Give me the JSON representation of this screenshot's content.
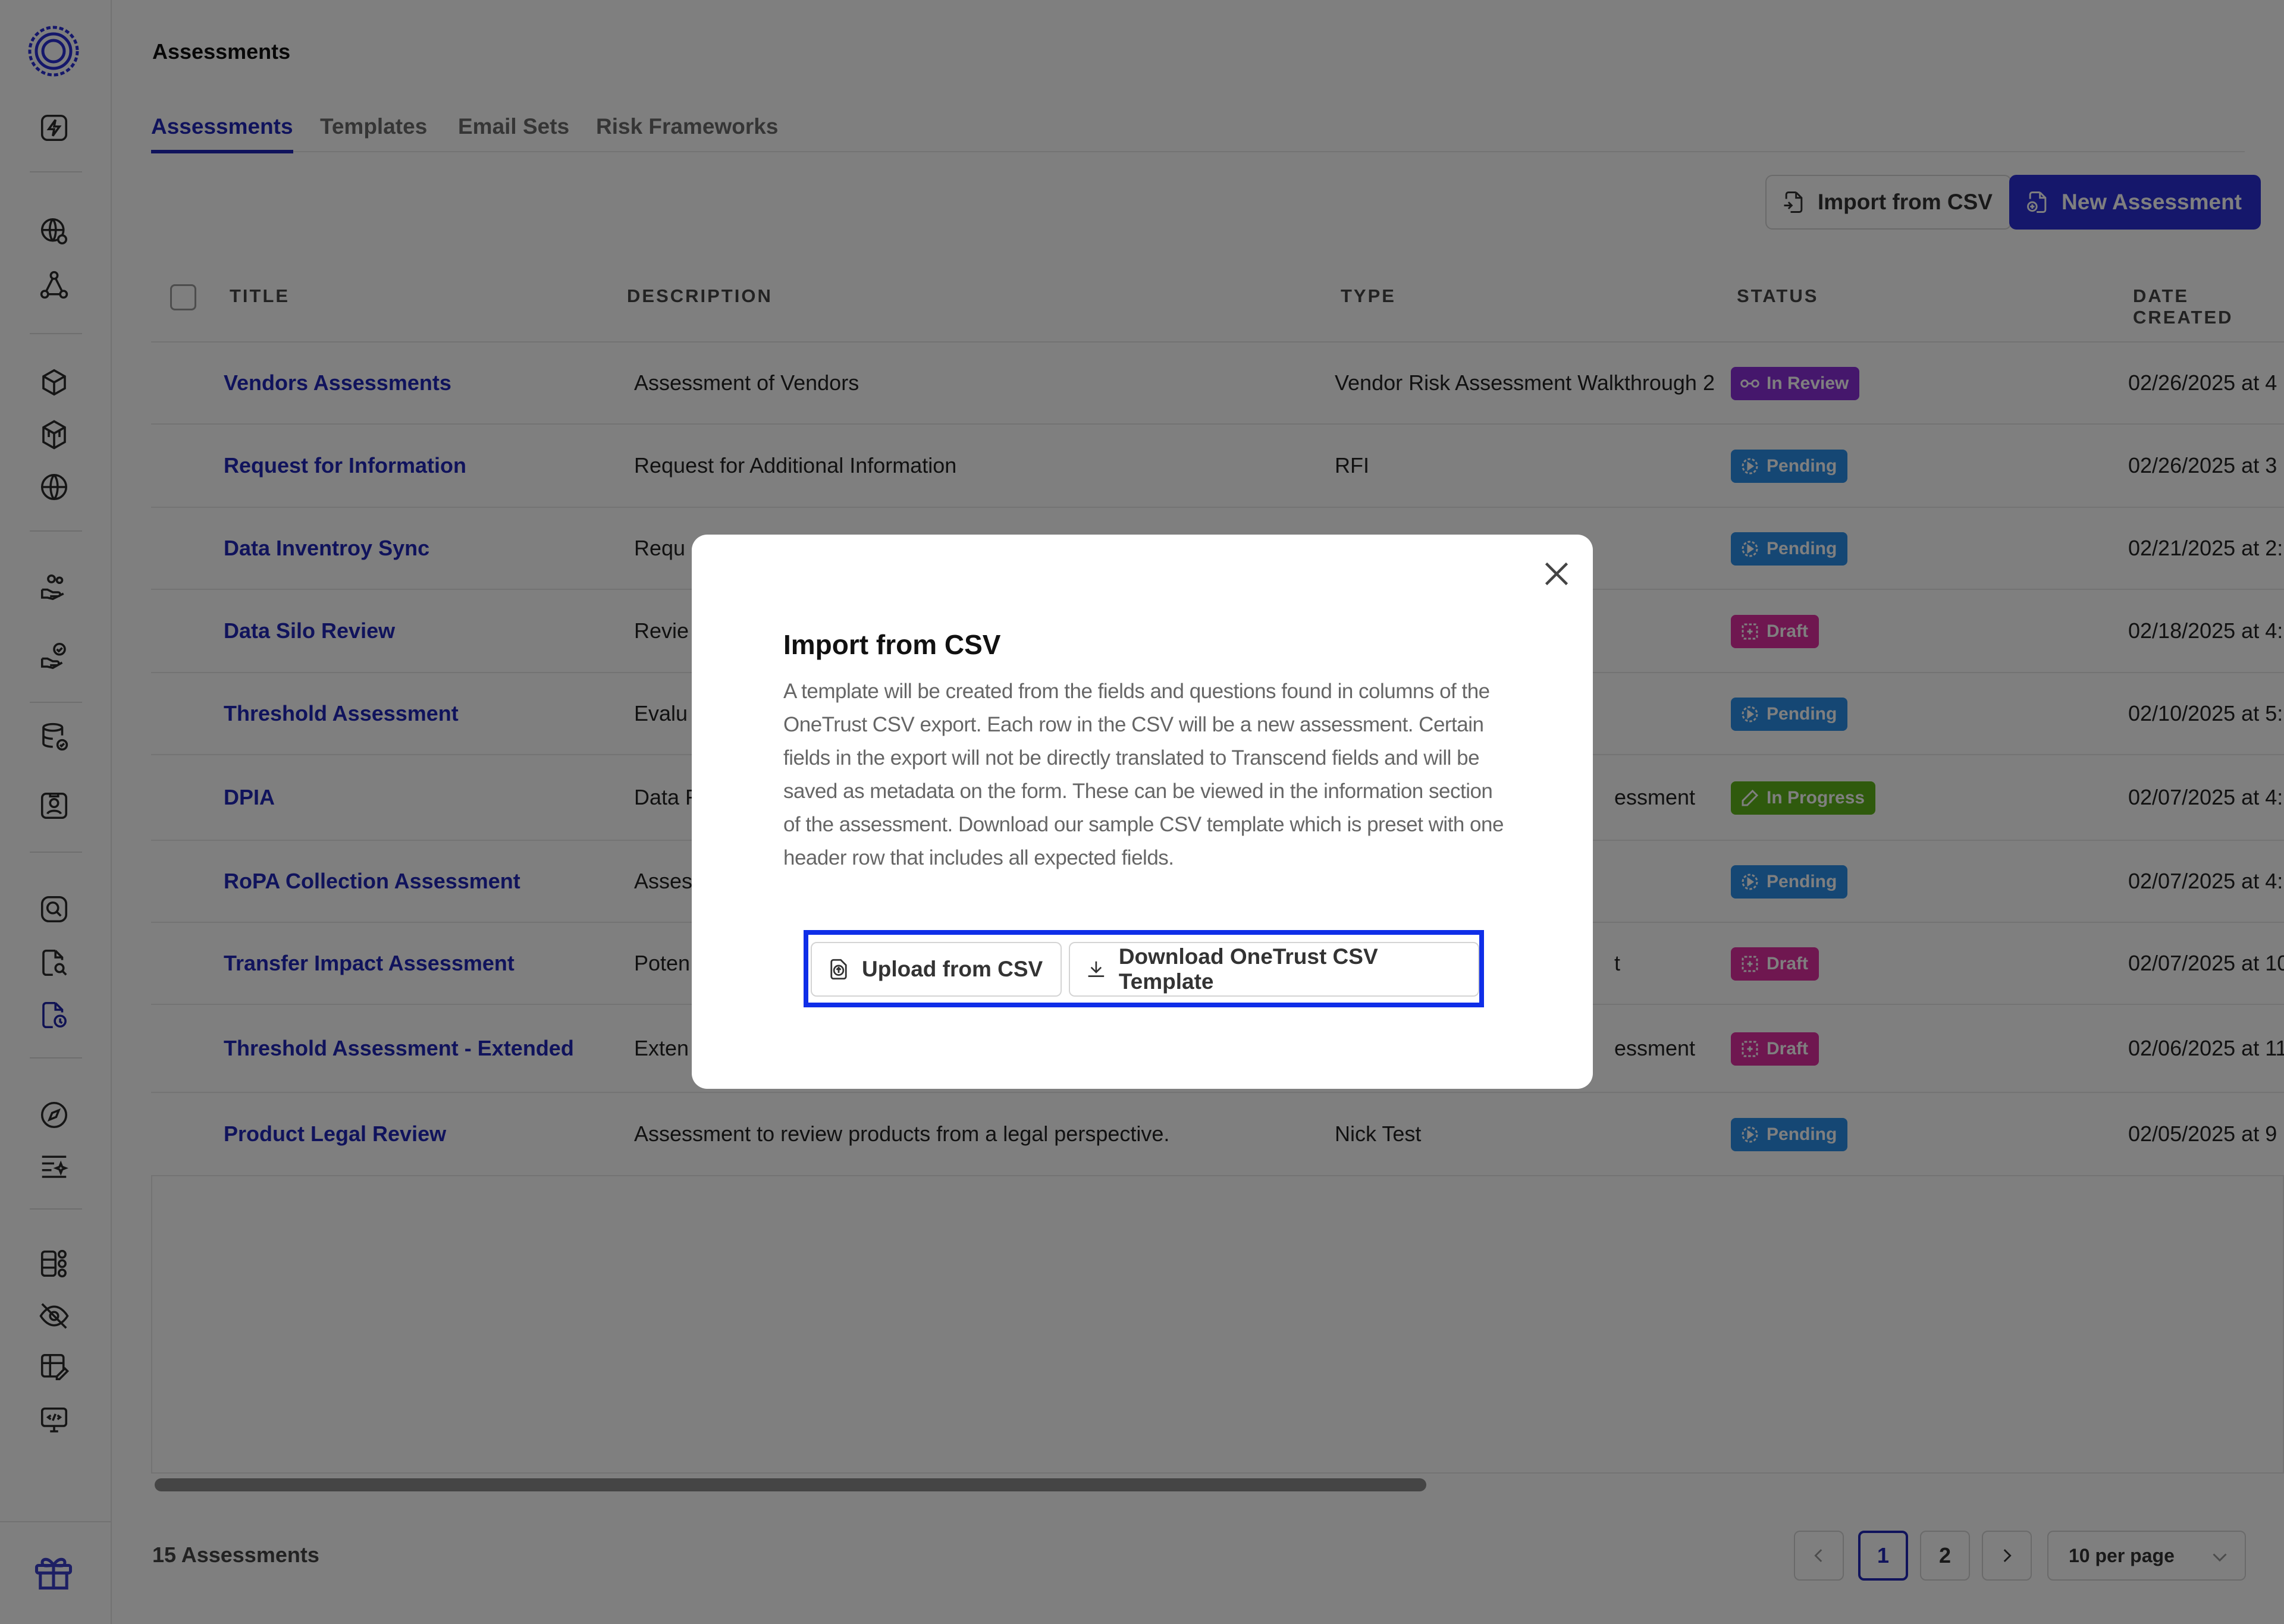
{
  "page": {
    "title": "Assessments"
  },
  "tabs": [
    {
      "label": "Assessments",
      "active": true
    },
    {
      "label": "Templates",
      "active": false
    },
    {
      "label": "Email Sets",
      "active": false
    },
    {
      "label": "Risk Frameworks",
      "active": false
    }
  ],
  "toolbar": {
    "import_label": "Import from CSV",
    "new_label": "New Assessment"
  },
  "table": {
    "columns": [
      "TITLE",
      "DESCRIPTION",
      "TYPE",
      "STATUS",
      "DATE CREATED"
    ],
    "rows": [
      {
        "title": "Vendors Assessments",
        "description": "Assessment of Vendors",
        "type": "Vendor Risk Assessment Walkthrough 2",
        "status": "In Review",
        "date": "02/26/2025 at 4"
      },
      {
        "title": "Request for Information",
        "description": "Request for Additional Information",
        "type": "RFI",
        "status": "Pending",
        "date": "02/26/2025 at 3"
      },
      {
        "title": "Data Inventroy Sync",
        "description": "Requ",
        "type": "",
        "status": "Pending",
        "date": "02/21/2025 at 2:"
      },
      {
        "title": "Data Silo Review",
        "description": "Revie",
        "type": "",
        "status": "Draft",
        "date": "02/18/2025 at 4:"
      },
      {
        "title": "Threshold Assessment",
        "description": "Evalu",
        "type": "",
        "status": "Pending",
        "date": "02/10/2025 at 5:"
      },
      {
        "title": "DPIA",
        "description": "Data F",
        "type": "essment",
        "status": "In Progress",
        "date": "02/07/2025 at 4:"
      },
      {
        "title": "RoPA Collection Assessment",
        "description": "Asses",
        "type": "",
        "status": "Pending",
        "date": "02/07/2025 at 4:"
      },
      {
        "title": "Transfer Impact Assessment",
        "description": "Poten",
        "type": "t",
        "status": "Draft",
        "date": "02/07/2025 at 10"
      },
      {
        "title": "Threshold Assessment - Extended",
        "description": "Exten",
        "type": "essment",
        "status": "Draft",
        "date": "02/06/2025 at 11"
      },
      {
        "title": "Product Legal Review",
        "description": "Assessment to review products from a legal perspective.",
        "type": "Nick Test",
        "status": "Pending",
        "date": "02/05/2025 at 9"
      }
    ]
  },
  "footer": {
    "count": "15 Assessments",
    "pages": [
      "1",
      "2"
    ],
    "current_page": "1",
    "per_page": "10 per page"
  },
  "modal": {
    "title": "Import from CSV",
    "body": "A template will be created from the fields and questions found in columns of the OneTrust CSV export. Each row in the CSV will be a new assessment. Certain fields in the export will not be directly translated to Transcend fields and will be saved as metadata on the form. These can be viewed in the information section of the assessment. Download our sample CSV template which is preset with one header row that includes all expected fields.",
    "upload_label": "Upload from CSV",
    "download_label": "Download OneTrust CSV Template"
  },
  "colors": {
    "accent": "#2127b8",
    "primary_button": "#2a2fd6",
    "highlight_border": "#0f2ee8",
    "status_in_review": "#8b2fd9",
    "status_pending": "#2b8ee8",
    "status_draft": "#de2ea0",
    "status_in_progress": "#5fb51a"
  },
  "icons": {
    "sidebar": [
      "logo-icon",
      "lightning-icon",
      "globe-settings-icon",
      "network-icon",
      "cube-icon",
      "cubes-icon",
      "globe-icon",
      "users-hand-icon",
      "hand-check-icon",
      "database-check-icon",
      "id-card-icon",
      "search-circle-icon",
      "document-search-icon",
      "document-shield-icon",
      "compass-icon",
      "list-sparkle-icon",
      "layout-grid-icon",
      "eye-off-icon",
      "grid-edit-icon",
      "monitor-code-icon",
      "gift-icon"
    ]
  }
}
